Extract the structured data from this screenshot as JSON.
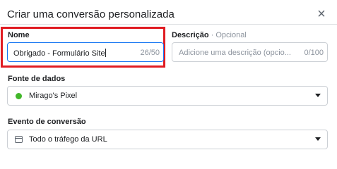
{
  "dialog": {
    "title": "Criar uma conversão personalizada",
    "close_glyph": "×"
  },
  "name_field": {
    "label": "Nome",
    "value": "Obrigado - Formulário Site",
    "counter": "26/50"
  },
  "description_field": {
    "label": "Descrição",
    "separator": " · ",
    "optional": "Opcional",
    "placeholder": "Adicione uma descrição (opcio...",
    "counter": "0/100"
  },
  "data_source": {
    "label": "Fonte de dados",
    "selected": "Mirago's Pixel",
    "status_color": "#42b72a"
  },
  "conversion_event": {
    "label": "Evento de conversão",
    "selected": "Todo o tráfego da URL",
    "icon": "browser-window-icon"
  },
  "colors": {
    "highlight": "#e01c22",
    "focus": "#1877f2"
  }
}
